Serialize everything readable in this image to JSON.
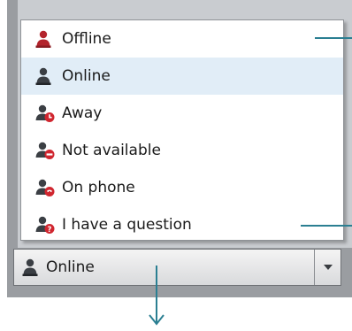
{
  "menu": {
    "items": [
      {
        "label": "Offline",
        "icon": "user-offline-icon",
        "icon_color": "#b3242c",
        "badge": "none",
        "selected": false
      },
      {
        "label": "Online",
        "icon": "user-online-icon",
        "icon_color": "#3b3f44",
        "badge": "none",
        "selected": true
      },
      {
        "label": "Away",
        "icon": "user-away-icon",
        "icon_color": "#3b3f44",
        "badge": "clock",
        "selected": false
      },
      {
        "label": "Not available",
        "icon": "user-not-available-icon",
        "icon_color": "#3b3f44",
        "badge": "minus",
        "selected": false
      },
      {
        "label": "On phone",
        "icon": "user-on-phone-icon",
        "icon_color": "#3b3f44",
        "badge": "phone",
        "selected": false
      },
      {
        "label": "I have a question",
        "icon": "user-question-icon",
        "icon_color": "#3b3f44",
        "badge": "question",
        "selected": false
      }
    ]
  },
  "combo": {
    "value": "Online",
    "icon": "user-online-icon",
    "arrow_icon": "triangle-down-icon"
  },
  "colors": {
    "accent_callout": "#2b7f92",
    "badge_red": "#d0262f",
    "selection_bg": "#e1edf7"
  }
}
